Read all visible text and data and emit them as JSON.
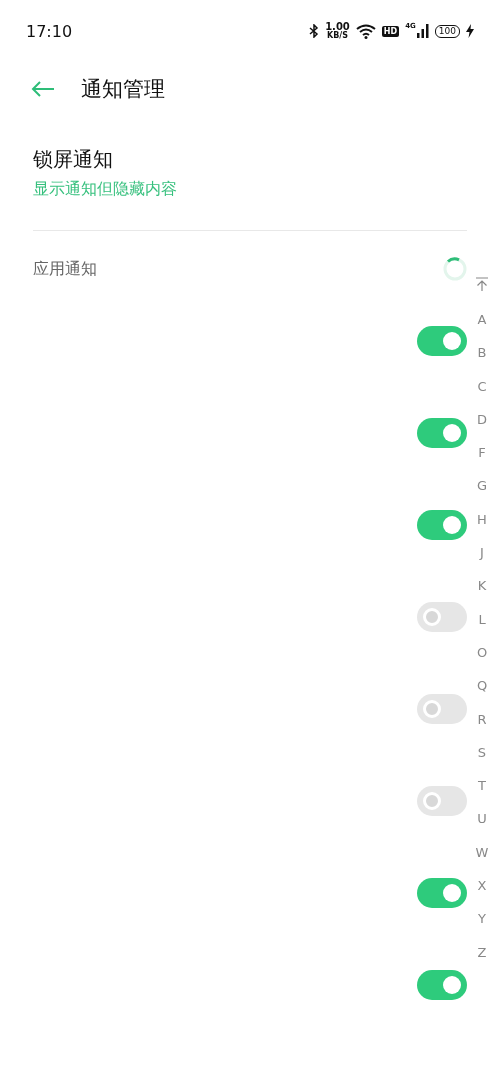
{
  "status_bar": {
    "time": "17:10",
    "speed_value": "1.00",
    "speed_unit": "KB/S",
    "hd_badge": "HD",
    "network": "4G",
    "battery": "100",
    "charging": true
  },
  "header": {
    "title": "通知管理"
  },
  "lock_screen": {
    "title": "锁屏通知",
    "value": "显示通知但隐藏内容"
  },
  "app_notifications": {
    "label": "应用通知",
    "loading": true,
    "toggles": [
      {
        "on": true
      },
      {
        "on": true
      },
      {
        "on": true
      },
      {
        "on": false
      },
      {
        "on": false
      },
      {
        "on": false
      },
      {
        "on": true
      },
      {
        "on": true
      }
    ]
  },
  "index_bar": [
    "A",
    "B",
    "C",
    "D",
    "F",
    "G",
    "H",
    "J",
    "K",
    "L",
    "O",
    "Q",
    "R",
    "S",
    "T",
    "U",
    "W",
    "X",
    "Y",
    "Z"
  ]
}
